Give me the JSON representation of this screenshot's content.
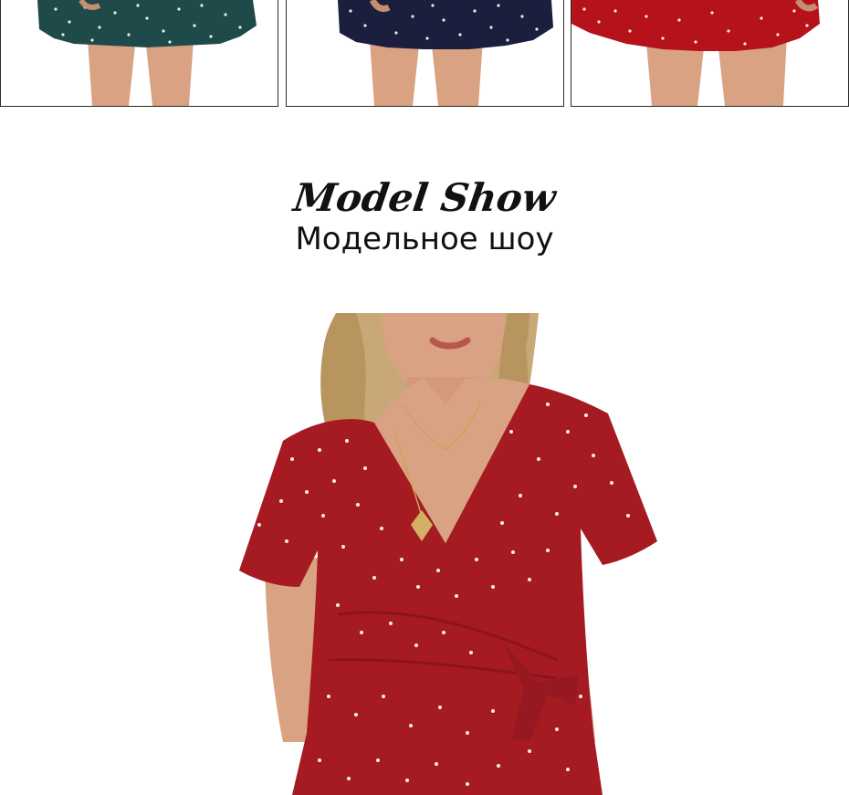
{
  "thumbnails": [
    {
      "variant": "dark-green polka dot skirt",
      "dress_color": "#1f4a4a",
      "dot_color": "#ffffff"
    },
    {
      "variant": "navy polka dot skirt",
      "dress_color": "#1b1f3d",
      "dot_color": "#ffffff"
    },
    {
      "variant": "red polka dot skirt",
      "dress_color": "#b5121b",
      "dot_color": "#ffffff"
    }
  ],
  "section": {
    "title": "Model Show",
    "subtitle": "Модельное шоу"
  },
  "model": {
    "dress_color": "#a61b22",
    "dot_color": "#ffffff",
    "skin_color": "#d9a283",
    "hair_color": "#c9a877"
  }
}
